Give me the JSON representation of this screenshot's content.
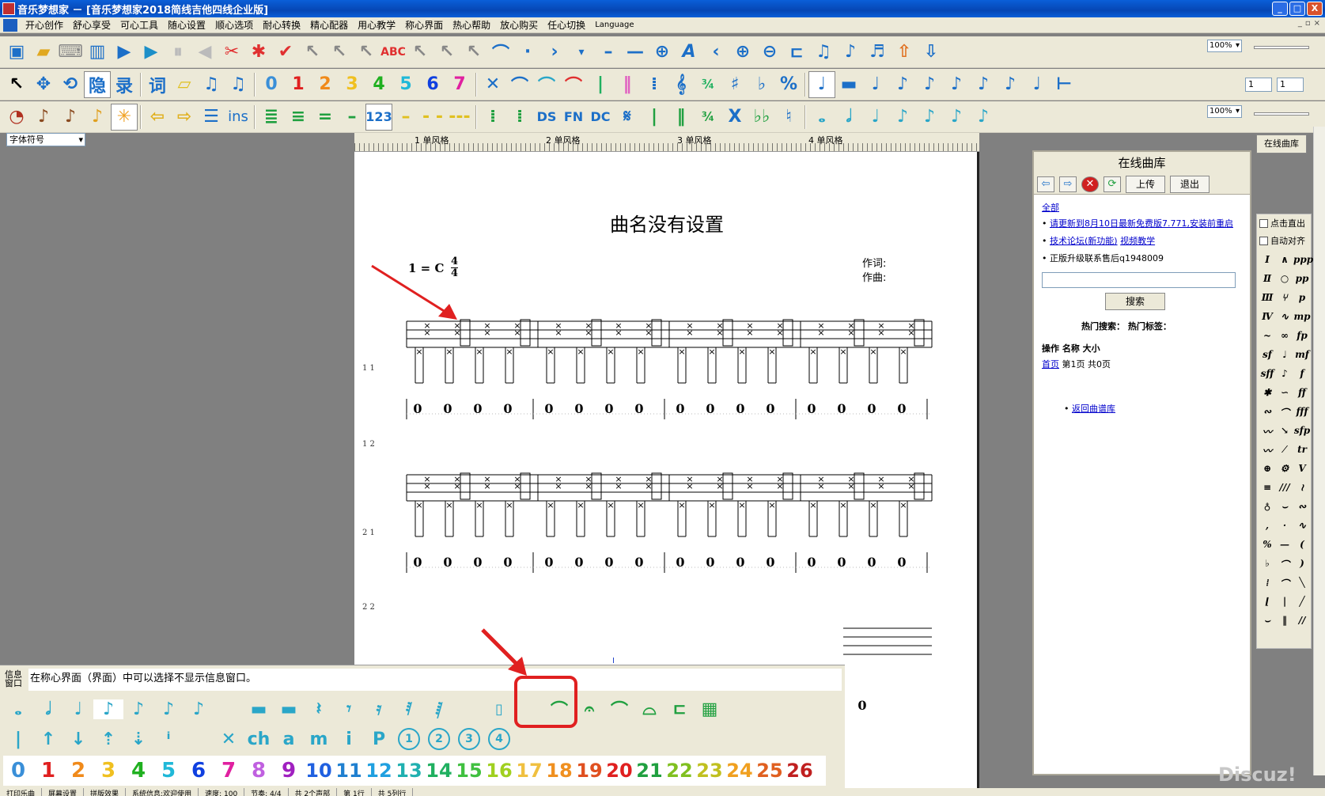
{
  "window": {
    "title": "音乐梦想家 － [音乐梦想家2018简线吉他四线企业版]",
    "minimize": "_",
    "maximize": "□",
    "close": "X"
  },
  "menu": [
    "开心创作",
    "舒心享受",
    "可心工具",
    "随心设置",
    "顺心选项",
    "耐心转换",
    "精心配器",
    "用心教学",
    "称心界面",
    "热心帮助",
    "放心购买",
    "任心切换",
    "Language"
  ],
  "toolbar": {
    "zoom1": "100%",
    "zoom2": "100%",
    "num1": "1",
    "num2": "1",
    "hide_label": "隐",
    "record_label": "录",
    "lyric_label": "词",
    "digits": [
      "0",
      "1",
      "2",
      "3",
      "4",
      "5",
      "6",
      "7"
    ],
    "ins_label": "ins",
    "label_123": "123",
    "ds_label": "DS",
    "fn_label": "FN",
    "dc_label": "DC"
  },
  "font_dropdown": "字体符号",
  "online_button": "在线曲库",
  "ruler": {
    "labels": [
      "1 单风格",
      "2 单风格",
      "3 单风格",
      "4 单风格"
    ]
  },
  "score": {
    "title": "曲名没有设置",
    "key": "1 = C",
    "time_top": "4",
    "time_bottom": "4",
    "lyricist": "作词:",
    "composer": "作曲:",
    "row_labels": [
      "1   1",
      "1   2",
      "2   1",
      "2   2"
    ],
    "tab_value": "0",
    "cursor": "I"
  },
  "library": {
    "title": "在线曲库",
    "upload": "上传",
    "exit": "退出",
    "all": "全部",
    "update_notice": "请更新到8月10日最新免费版7.771,安装前重启",
    "forum": "技术论坛(新功能)",
    "video": "视频教学",
    "support": "正版升级联系售后q1948009",
    "search_btn": "搜索",
    "hot": "热门搜索：  热门标签：",
    "cols": "操作  名称  大小",
    "home": "首页",
    "page_info": "第1页  共0页",
    "back": "返回曲谱库"
  },
  "palette": {
    "auto_out": "点击直出",
    "auto_align": "自动对齐",
    "dynamics": [
      "ppp",
      "pp",
      "p",
      "mp",
      "fp",
      "mf",
      "f",
      "ff",
      "fff",
      "sfp",
      "sf",
      "sff"
    ]
  },
  "info": {
    "label": "信息窗口",
    "text": "在称心界面（界面）中可以选择不显示信息窗口。"
  },
  "bottom": {
    "ch_label": "ch",
    "a_label": "a",
    "m_label": "m",
    "i_label": "i",
    "p_label": "P",
    "circled": [
      "1",
      "2",
      "3",
      "4"
    ],
    "numbers": [
      "0",
      "1",
      "2",
      "3",
      "4",
      "5",
      "6",
      "7",
      "8",
      "9",
      "10",
      "11",
      "12",
      "13",
      "14",
      "15",
      "16",
      "17",
      "18",
      "19",
      "20",
      "21",
      "22",
      "23",
      "24",
      "25",
      "26"
    ],
    "number_colors": [
      "#3a8fd8",
      "#e02020",
      "#f08a1a",
      "#f0c020",
      "#20b020",
      "#20b8d8",
      "#1040e0",
      "#e020a0",
      "#c060e0",
      "#a020c0",
      "#2060e0",
      "#2080d0",
      "#20a0e0",
      "#20b0b0",
      "#20b060",
      "#40c040",
      "#a0d020",
      "#f0c040",
      "#f09020",
      "#e05020",
      "#e02020",
      "#20a040",
      "#80c020",
      "#c0c020",
      "#f0a020",
      "#e06020",
      "#c02020"
    ]
  },
  "status": [
    "打印乐曲",
    "屏幕设置",
    "拼版效果",
    "系统信息:欢迎使用",
    "速度: 100",
    "节奏: 4/4",
    "共 2个声部",
    "第 1行",
    "共 5列行"
  ],
  "watermark": "Discuz!"
}
